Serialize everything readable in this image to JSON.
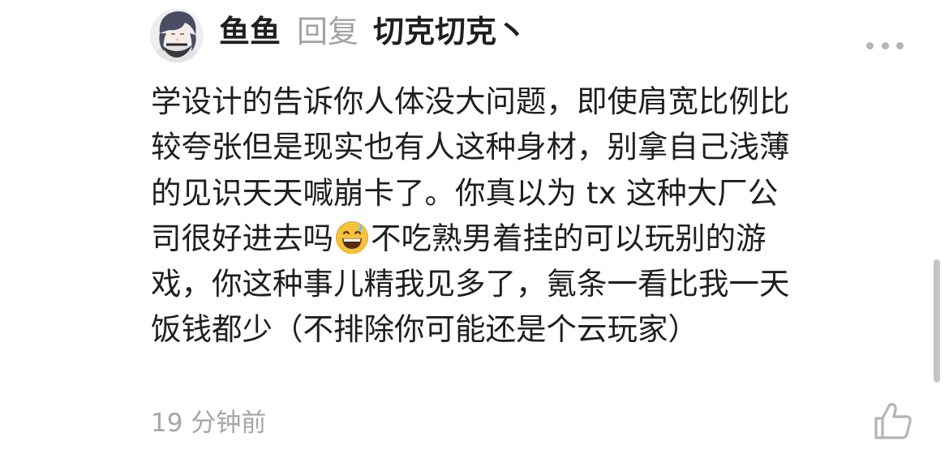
{
  "comment": {
    "author": "鱼鱼",
    "reply_word": "回复",
    "reply_to": "切克切克丶",
    "avatar_icon": "user-avatar",
    "more_icon": "more-dots-icon",
    "text_lines": [
      "学设计的告诉你人体没大问题，即使肩宽比例比",
      "较夸张但是现实也有人这种身材，别拿自己浅薄",
      "的见识天天喊崩卡了。你真以为 tx 这种大厂公"
    ],
    "line4_before_emoji": "司很好进去吗",
    "emoji_icon": "grinning-sweat-emoji-icon",
    "line4_after_emoji": "不吃熟男着挂的可以玩别的游",
    "text_lines_after": [
      "戏，你这种事儿精我见多了，氪条一看比我一天",
      "饭钱都少（不排除你可能还是个云玩家）"
    ],
    "timestamp": "19 分钟前",
    "like_icon": "thumbs-up-icon"
  },
  "colors": {
    "text_primary": "#1f1f1f",
    "text_secondary": "#a3a3a3",
    "icon_gray": "#b5b5b5",
    "background": "#ffffff"
  }
}
